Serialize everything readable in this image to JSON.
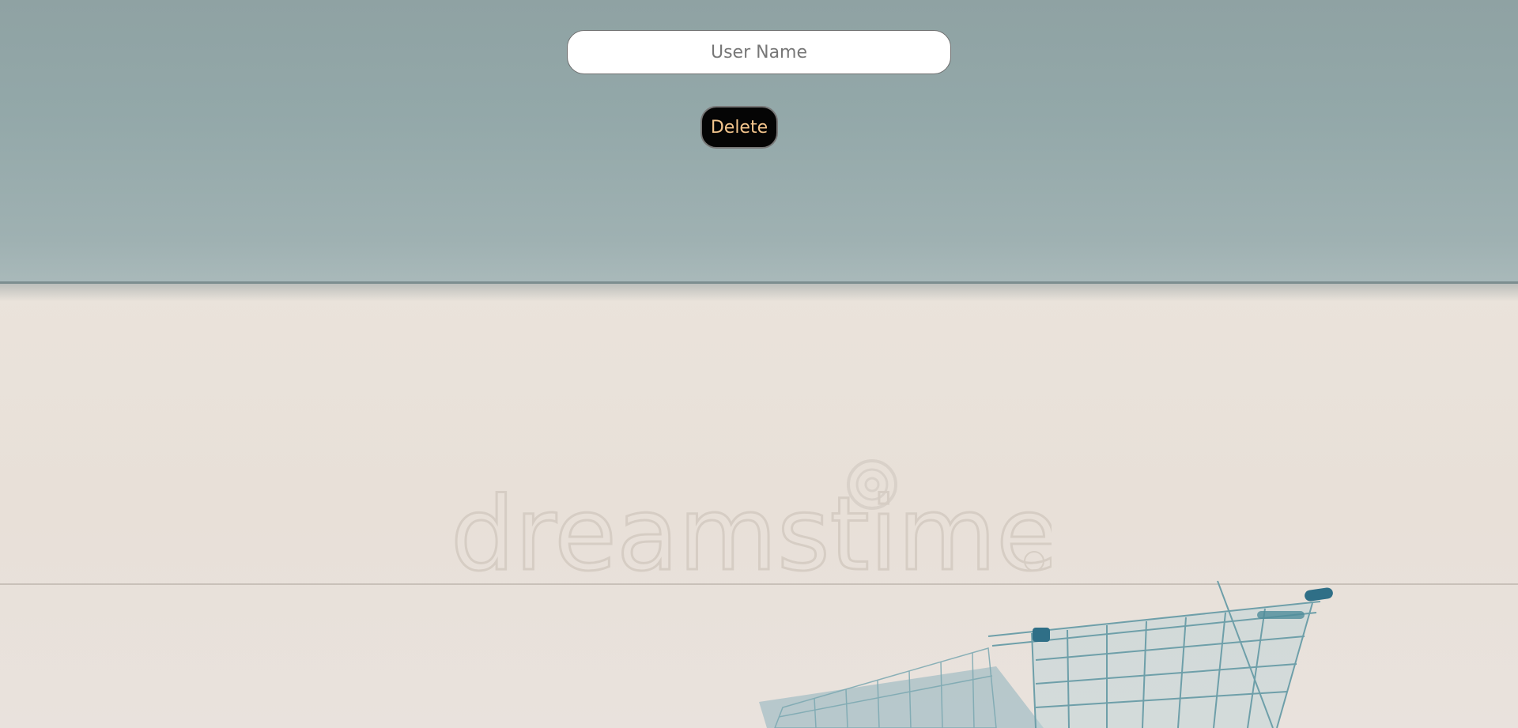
{
  "form": {
    "username": {
      "value": "",
      "placeholder": "User Name"
    },
    "delete_label": "Delete"
  },
  "background": {
    "watermark_text": "dreamstime",
    "colors": {
      "wall": "#93a8a9",
      "floor": "#e8e0d8",
      "cart": "#4f8c9a"
    }
  },
  "theme": {
    "button_bg": "#050505",
    "button_text": "#f2c48c",
    "input_bg": "#ffffff"
  }
}
